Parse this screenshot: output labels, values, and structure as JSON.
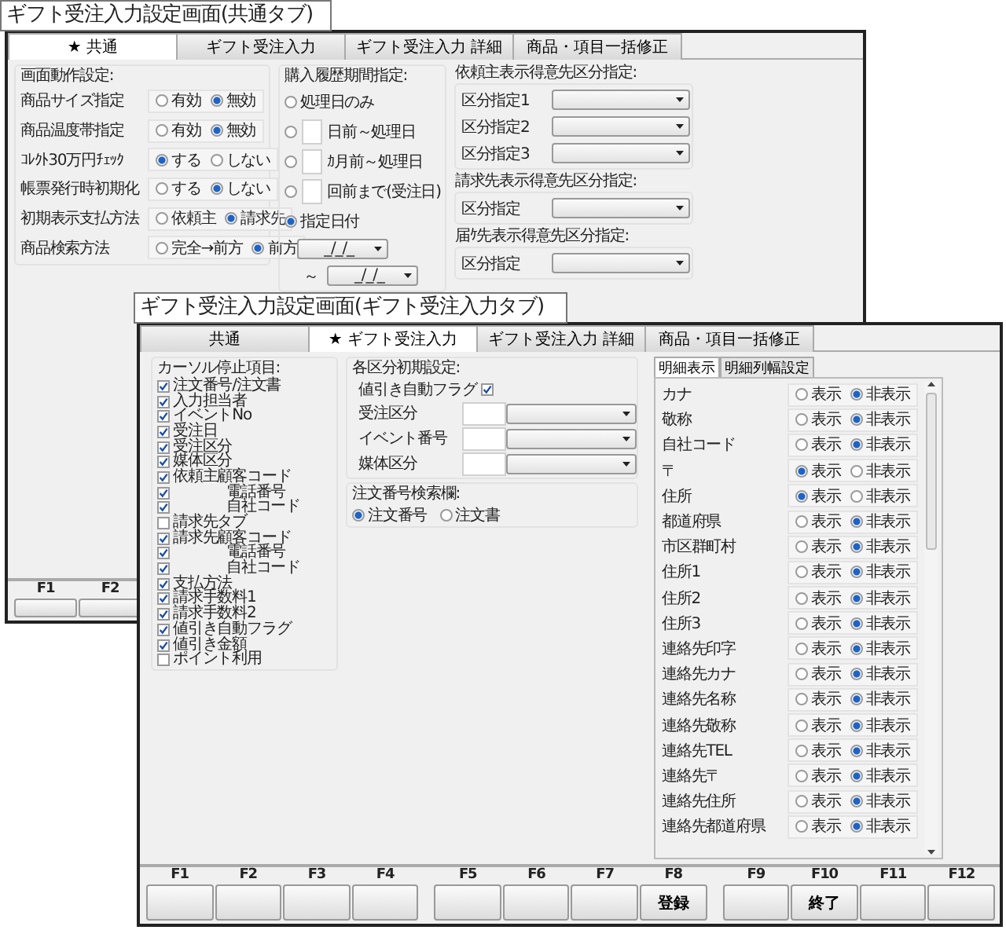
{
  "screen_common": {
    "caption": "ギフト受注入力設定画面(共通タブ)",
    "tabs": [
      {
        "label": "★ 共通",
        "selected": true
      },
      {
        "label": "ギフト受注入力",
        "selected": false
      },
      {
        "label": "ギフト受注入力 詳細",
        "selected": false
      },
      {
        "label": "商品・項目一括修正",
        "selected": false
      }
    ],
    "operation_settings": {
      "title": "画面動作設定:",
      "rows": [
        {
          "label": "商品サイズ指定",
          "options": [
            {
              "label": "有効",
              "selected": false
            },
            {
              "label": "無効",
              "selected": true
            }
          ]
        },
        {
          "label": "商品温度帯指定",
          "options": [
            {
              "label": "有効",
              "selected": false
            },
            {
              "label": "無効",
              "selected": true
            }
          ]
        },
        {
          "label": "ｺﾚｸﾄ30万円ﾁｪｯｸ",
          "options": [
            {
              "label": "する",
              "selected": true
            },
            {
              "label": "しない",
              "selected": false
            }
          ]
        },
        {
          "label": "帳票発行時初期化",
          "options": [
            {
              "label": "する",
              "selected": false
            },
            {
              "label": "しない",
              "selected": true
            }
          ]
        },
        {
          "label": "初期表示支払方法",
          "options": [
            {
              "label": "依頼主",
              "selected": false
            },
            {
              "label": "請求先",
              "selected": true
            }
          ]
        },
        {
          "label": "商品検索方法",
          "options": [
            {
              "label": "完全→前方",
              "selected": false
            },
            {
              "label": "前方",
              "selected": true
            }
          ]
        }
      ]
    },
    "history_period": {
      "title": "購入履歴期間指定:",
      "options": [
        {
          "kind": "plain",
          "label": "処理日のみ",
          "selected": false
        },
        {
          "kind": "count",
          "label": "日前～処理日",
          "selected": false
        },
        {
          "kind": "count",
          "label": "ｶ月前～処理日",
          "selected": false
        },
        {
          "kind": "count",
          "label": "回前まで(受注日)",
          "selected": false
        },
        {
          "kind": "plain",
          "label": "指定日付",
          "selected": true
        }
      ],
      "date_from": "_/_/_",
      "range_mark": "～",
      "date_to": "_/_/_"
    },
    "classification_groups": [
      {
        "title": "依頼主表示得意先区分指定:",
        "fields": [
          "区分指定1",
          "区分指定2",
          "区分指定3"
        ]
      },
      {
        "title": "請求先表示得意先区分指定:",
        "fields": [
          "区分指定"
        ]
      },
      {
        "title": "届ｹ先表示得意先区分指定:",
        "fields": [
          "区分指定"
        ]
      }
    ],
    "function_keys": [
      {
        "key": "F1"
      },
      {
        "key": "F2"
      }
    ]
  },
  "screen_gift_order": {
    "caption": "ギフト受注入力設定画面(ギフト受注入力タブ)",
    "tabs": [
      {
        "label": "共通",
        "selected": false
      },
      {
        "label": "★ ギフト受注入力",
        "selected": true
      },
      {
        "label": "ギフト受注入力 詳細",
        "selected": false
      },
      {
        "label": "商品・項目一括修正",
        "selected": false
      }
    ],
    "cursor_stop": {
      "title": "カーソル停止項目:",
      "items": [
        {
          "label": "注文番号/注文書",
          "checked": true
        },
        {
          "label": "入力担当者",
          "checked": true
        },
        {
          "label": "イベントNo",
          "checked": true
        },
        {
          "label": "受注日",
          "checked": true
        },
        {
          "label": "受注区分",
          "checked": true
        },
        {
          "label": "媒体区分",
          "checked": true
        },
        {
          "label": "依頼主顧客コード",
          "checked": true,
          "children": [
            {
              "label": "電話番号",
              "checked": true
            },
            {
              "label": "自社コード",
              "checked": true
            }
          ]
        },
        {
          "label": "請求先タブ",
          "checked": false
        },
        {
          "label": "請求先顧客コード",
          "checked": true,
          "children": [
            {
              "label": "電話番号",
              "checked": true
            },
            {
              "label": "自社コード",
              "checked": true
            }
          ]
        },
        {
          "label": "支払方法",
          "checked": true
        },
        {
          "label": "請求手数料1",
          "checked": true
        },
        {
          "label": "請求手数料2",
          "checked": true
        },
        {
          "label": "値引き自動フラグ",
          "checked": true
        },
        {
          "label": "値引き金額",
          "checked": true
        },
        {
          "label": "ポイント利用",
          "checked": false
        }
      ]
    },
    "initial_settings": {
      "title": "各区分初期設定:",
      "auto_discount": {
        "label": "値引き自動フラグ",
        "checked": true
      },
      "fields": [
        "受注区分",
        "イベント番号",
        "媒体区分"
      ]
    },
    "order_search": {
      "title": "注文番号検索欄:",
      "options": [
        {
          "label": "注文番号",
          "selected": true
        },
        {
          "label": "注文書",
          "selected": false
        }
      ]
    },
    "detail_tabs": [
      {
        "label": "明細表示",
        "selected": true
      },
      {
        "label": "明細列幅設定",
        "selected": false
      }
    ],
    "detail_rows": [
      {
        "label": "カナ",
        "options": [
          {
            "label": "表示",
            "selected": false
          },
          {
            "label": "非表示",
            "selected": true
          }
        ]
      },
      {
        "label": "敬称",
        "options": [
          {
            "label": "表示",
            "selected": false
          },
          {
            "label": "非表示",
            "selected": true
          }
        ]
      },
      {
        "label": "自社コード",
        "options": [
          {
            "label": "表示",
            "selected": false
          },
          {
            "label": "非表示",
            "selected": true
          }
        ]
      },
      {
        "label": "〒",
        "options": [
          {
            "label": "表示",
            "selected": true
          },
          {
            "label": "非表示",
            "selected": false
          }
        ]
      },
      {
        "label": "住所",
        "options": [
          {
            "label": "表示",
            "selected": true
          },
          {
            "label": "非表示",
            "selected": false
          }
        ]
      },
      {
        "label": "都道府県",
        "options": [
          {
            "label": "表示",
            "selected": false
          },
          {
            "label": "非表示",
            "selected": true
          }
        ]
      },
      {
        "label": "市区群町村",
        "options": [
          {
            "label": "表示",
            "selected": false
          },
          {
            "label": "非表示",
            "selected": true
          }
        ]
      },
      {
        "label": "住所1",
        "options": [
          {
            "label": "表示",
            "selected": false
          },
          {
            "label": "非表示",
            "selected": true
          }
        ]
      },
      {
        "label": "住所2",
        "options": [
          {
            "label": "表示",
            "selected": false
          },
          {
            "label": "非表示",
            "selected": true
          }
        ]
      },
      {
        "label": "住所3",
        "options": [
          {
            "label": "表示",
            "selected": false
          },
          {
            "label": "非表示",
            "selected": true
          }
        ]
      },
      {
        "label": "連絡先印字",
        "options": [
          {
            "label": "表示",
            "selected": false
          },
          {
            "label": "非表示",
            "selected": true
          }
        ]
      },
      {
        "label": "連絡先カナ",
        "options": [
          {
            "label": "表示",
            "selected": false
          },
          {
            "label": "非表示",
            "selected": true
          }
        ]
      },
      {
        "label": "連絡先名称",
        "options": [
          {
            "label": "表示",
            "selected": false
          },
          {
            "label": "非表示",
            "selected": true
          }
        ]
      },
      {
        "label": "連絡先敬称",
        "options": [
          {
            "label": "表示",
            "selected": false
          },
          {
            "label": "非表示",
            "selected": true
          }
        ]
      },
      {
        "label": "連絡先TEL",
        "options": [
          {
            "label": "表示",
            "selected": false
          },
          {
            "label": "非表示",
            "selected": true
          }
        ]
      },
      {
        "label": "連絡先〒",
        "options": [
          {
            "label": "表示",
            "selected": false
          },
          {
            "label": "非表示",
            "selected": true
          }
        ]
      },
      {
        "label": "連絡先住所",
        "options": [
          {
            "label": "表示",
            "selected": false
          },
          {
            "label": "非表示",
            "selected": true
          }
        ]
      },
      {
        "label": "連絡先都道府県",
        "options": [
          {
            "label": "表示",
            "selected": false
          },
          {
            "label": "非表示",
            "selected": true
          }
        ]
      }
    ],
    "function_keys": [
      {
        "key": "F1"
      },
      {
        "key": "F2"
      },
      {
        "key": "F3"
      },
      {
        "key": "F4"
      },
      {
        "key": "F5"
      },
      {
        "key": "F6"
      },
      {
        "key": "F7"
      },
      {
        "key": "F8",
        "label": "登録"
      },
      {
        "key": "F9"
      },
      {
        "key": "F10",
        "label": "終了"
      },
      {
        "key": "F11"
      },
      {
        "key": "F12"
      }
    ]
  }
}
